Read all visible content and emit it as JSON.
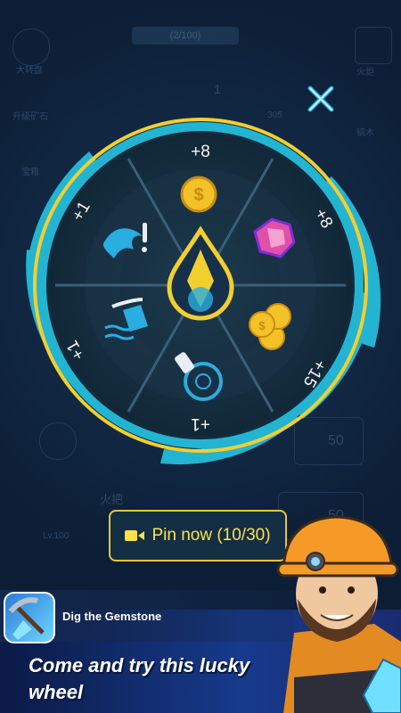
{
  "background": {
    "counter": "(2/100)",
    "left_labels": [
      "大转盘",
      "升级矿石",
      "宝箱"
    ],
    "right_labels": [
      "火炬",
      "镐木"
    ],
    "level": "Lv.100",
    "torch_label": "火把",
    "ghost_numbers": [
      "1",
      "305",
      "50",
      "50"
    ]
  },
  "wheel": {
    "segments": [
      {
        "label": "+8",
        "reward": "coin"
      },
      {
        "label": "+8",
        "reward": "gem"
      },
      {
        "label": "+15",
        "reward": "coins"
      },
      {
        "label": "+1",
        "reward": "compass-drill"
      },
      {
        "label": "+1",
        "reward": "water-bucket"
      },
      {
        "label": "+1",
        "reward": "blue-flame"
      }
    ],
    "colors": {
      "ring": "#23b4d2",
      "gold": "#f2cf2f",
      "dark": "#152c3e",
      "spoke": "#3a6078"
    }
  },
  "pin_button": {
    "label": "Pin now (10/30)"
  },
  "ad": {
    "app_name": "Dig the Gemstone",
    "tagline_line1": "Come and try this lucky",
    "tagline_line2": "wheel"
  }
}
